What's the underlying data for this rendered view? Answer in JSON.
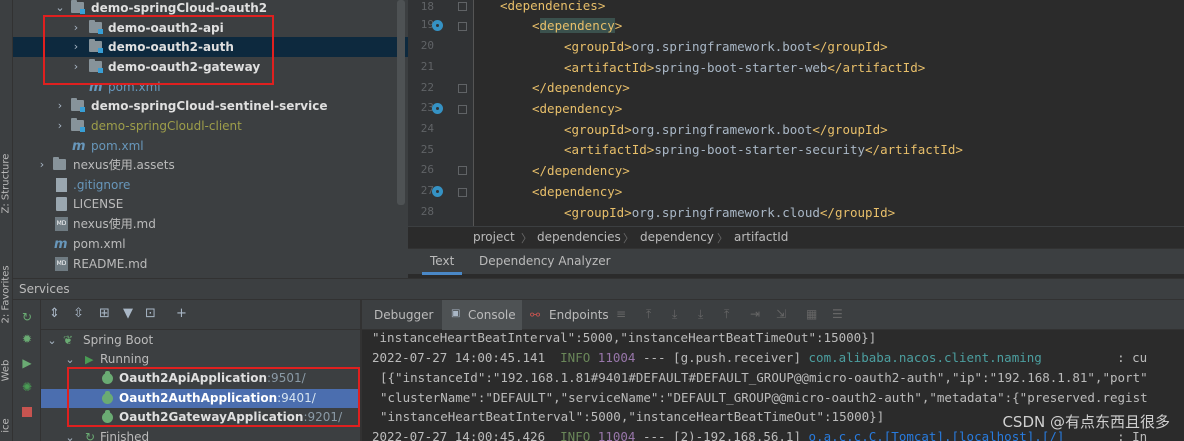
{
  "left_stripe": {
    "tabs": [
      "Z: Structure",
      "2: Favorites",
      "Web",
      "ice"
    ]
  },
  "tree": {
    "items": [
      {
        "label": "demo-springCloud-oauth2",
        "kind": "module",
        "indent": 1,
        "expanded": true
      },
      {
        "label": "demo-oauth2-api",
        "kind": "module",
        "indent": 2
      },
      {
        "label": "demo-oauth2-auth",
        "kind": "module",
        "indent": 2
      },
      {
        "label": "demo-oauth2-gateway",
        "kind": "module",
        "indent": 2
      },
      {
        "label": "pom.xml",
        "kind": "pom",
        "indent": 2
      },
      {
        "label": "demo-springCloud-sentinel-service",
        "kind": "module",
        "indent": 1
      },
      {
        "label": "demo-springCloudl-client",
        "kind": "module",
        "indent": 1
      },
      {
        "label": "pom.xml",
        "kind": "pom",
        "indent": 1
      },
      {
        "label": "nexus使用.assets",
        "kind": "folder",
        "indent": 0
      },
      {
        "label": ".gitignore",
        "kind": "git",
        "indent": 0
      },
      {
        "label": "LICENSE",
        "kind": "file",
        "indent": 0
      },
      {
        "label": "nexus使用.md",
        "kind": "md",
        "indent": 0
      },
      {
        "label": "pom.xml",
        "kind": "pom",
        "indent": 0
      },
      {
        "label": "README.md",
        "kind": "md",
        "indent": 0
      }
    ]
  },
  "editor": {
    "line_numbers": [
      "18",
      "19",
      "20",
      "21",
      "22",
      "23",
      "24",
      "25",
      "26",
      "27",
      "28"
    ],
    "lines": [
      {
        "indent": 1,
        "parts": [
          {
            "t": "tag",
            "v": "<dependencies>"
          }
        ]
      },
      {
        "indent": 2,
        "parts": [
          {
            "t": "tag",
            "v": "<"
          },
          {
            "t": "hl",
            "v": "dependency"
          },
          {
            "t": "tag",
            "v": ">"
          }
        ]
      },
      {
        "indent": 3,
        "parts": [
          {
            "t": "tag",
            "v": "<groupId>"
          },
          {
            "t": "txt",
            "v": "org.springframework.boot"
          },
          {
            "t": "tag",
            "v": "</groupId>"
          }
        ]
      },
      {
        "indent": 3,
        "parts": [
          {
            "t": "tag",
            "v": "<artifactId>"
          },
          {
            "t": "txt",
            "v": "spring-boot-starter-web"
          },
          {
            "t": "tag",
            "v": "</artifactId>"
          }
        ]
      },
      {
        "indent": 2,
        "parts": [
          {
            "t": "tag",
            "v": "</dependency>"
          }
        ]
      },
      {
        "indent": 2,
        "parts": [
          {
            "t": "tag",
            "v": "<dependency>"
          }
        ]
      },
      {
        "indent": 3,
        "parts": [
          {
            "t": "tag",
            "v": "<groupId>"
          },
          {
            "t": "txt",
            "v": "org.springframework.boot"
          },
          {
            "t": "tag",
            "v": "</groupId>"
          }
        ]
      },
      {
        "indent": 3,
        "parts": [
          {
            "t": "tag",
            "v": "<artifactId>"
          },
          {
            "t": "txt",
            "v": "spring-boot-starter-security"
          },
          {
            "t": "tag",
            "v": "</artifactId>"
          }
        ]
      },
      {
        "indent": 2,
        "parts": [
          {
            "t": "tag",
            "v": "</dependency>"
          }
        ]
      },
      {
        "indent": 2,
        "parts": [
          {
            "t": "tag",
            "v": "<dependency>"
          }
        ]
      },
      {
        "indent": 3,
        "parts": [
          {
            "t": "tag",
            "v": "<groupId>"
          },
          {
            "t": "txt",
            "v": "org.springframework.cloud"
          },
          {
            "t": "tag",
            "v": "</groupId>"
          }
        ]
      }
    ]
  },
  "breadcrumb": [
    "project",
    "dependencies",
    "dependency",
    "artifactId"
  ],
  "editor_tabs": {
    "text": "Text",
    "dependency_analyzer": "Dependency Analyzer"
  },
  "services": {
    "title": "Services",
    "tree": {
      "spring_boot": "Spring Boot",
      "running": "Running",
      "apps": [
        {
          "name": "Oauth2ApiApplication",
          "port": ":9501/"
        },
        {
          "name": "Oauth2AuthApplication",
          "port": ":9401/"
        },
        {
          "name": "Oauth2GatewayApplication",
          "port": ":9201/"
        }
      ],
      "finished": "Finished"
    },
    "console_tabs": {
      "debugger": "Debugger",
      "console": "Console",
      "endpoints": "Endpoints"
    },
    "console_lines": [
      [
        {
          "t": "plain",
          "v": "\"instanceHeartBeatInterval\":5000,\"instanceHeartBeatTimeOut\":15000}]"
        }
      ],
      [
        {
          "t": "plain",
          "v": "2022-07-27 14:00:45.141  "
        },
        {
          "t": "info",
          "v": "INFO"
        },
        {
          "t": "pid",
          "v": " 11004"
        },
        {
          "t": "plain",
          "v": " --- [g.push.receiver] "
        },
        {
          "t": "logger",
          "v": "com.alibaba.nacos.client.naming"
        },
        {
          "t": "plain",
          "v": "          : cu"
        }
      ],
      [
        {
          "t": "plain",
          "v": "[{\"instanceId\":\"192.168.1.81#9401#DEFAULT#DEFAULT_GROUP@@micro-oauth2-auth\",\"ip\":\"192.168.1.81\",\"port\""
        }
      ],
      [
        {
          "t": "plain",
          "v": "\"clusterName\":\"DEFAULT\",\"serviceName\":\"DEFAULT_GROUP@@micro-oauth2-auth\",\"metadata\":{\"preserved.regist"
        }
      ],
      [
        {
          "t": "plain",
          "v": "\"instanceHeartBeatInterval\":5000,\"instanceHeartBeatTimeOut\":15000}]"
        }
      ],
      [
        {
          "t": "plain",
          "v": "2022-07-27 14:00:45.426  "
        },
        {
          "t": "info",
          "v": "INFO"
        },
        {
          "t": "pid",
          "v": " 11004"
        },
        {
          "t": "plain",
          "v": " --- [2)-192.168.56.1] "
        },
        {
          "t": "logger",
          "v": "o.a.c.c.C.[Tomcat].[localhost].[/]"
        },
        {
          "t": "plain",
          "v": "       : In"
        }
      ]
    ]
  },
  "watermark": "CSDN @有点东西且很多",
  "colors": {
    "selection": "#0d293e",
    "service_selection": "#4b6eaf",
    "highlight_box": "#e0201f",
    "tag": "#e8bf6a"
  }
}
